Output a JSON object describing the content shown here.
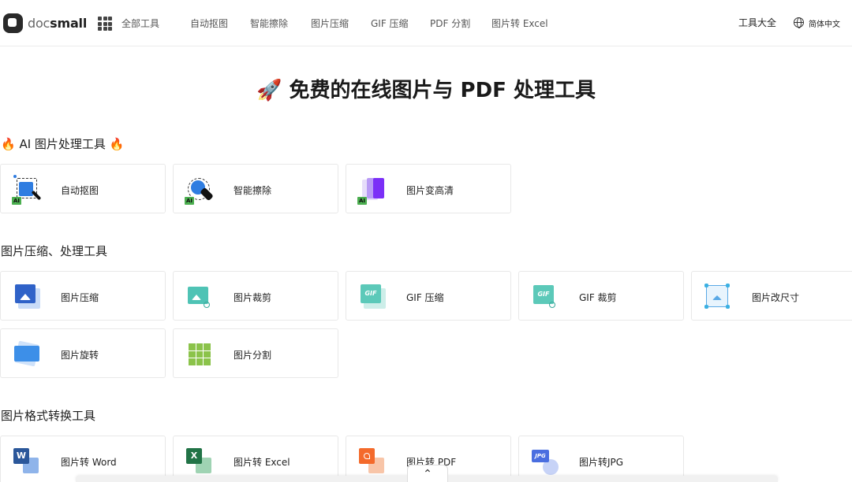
{
  "header": {
    "logo_prefix": "doc",
    "logo_suffix": "small",
    "all_tools": "全部工具",
    "nav": [
      "自动抠图",
      "智能擦除",
      "图片压缩",
      "GIF 压缩",
      "PDF 分割",
      "图片转 Excel"
    ],
    "tools_all": "工具大全",
    "language": "简体中文"
  },
  "hero": {
    "title": "🚀 免费的在线图片与 PDF 处理工具"
  },
  "sections": {
    "ai": {
      "title": "🔥 AI 图片处理工具 🔥",
      "cards": [
        "自动抠图",
        "智能擦除",
        "图片变高清"
      ],
      "tag": "AI"
    },
    "compress": {
      "title": "图片压缩、处理工具",
      "cards": [
        "图片压缩",
        "图片裁剪",
        "GIF 压缩",
        "GIF 裁剪",
        "图片改尺寸",
        "图片旋转",
        "图片分割"
      ]
    },
    "convert": {
      "title": "图片格式转换工具",
      "cards": [
        "图片转 Word",
        "图片转 Excel",
        "图片转 PDF",
        "图片转JPG"
      ]
    }
  },
  "icon_glyphs": {
    "gif": "GIF",
    "word": "W",
    "excel": "X",
    "jpg": "JPG"
  },
  "icons": [
    "grid-icon",
    "globe-icon",
    "cutout-icon",
    "erase-icon",
    "enhance-icon",
    "compress-icon",
    "crop-icon",
    "gif-compress-icon",
    "gif-crop-icon",
    "resize-icon",
    "rotate-icon",
    "split-icon",
    "word-icon",
    "excel-icon",
    "pdf-icon",
    "jpg-icon",
    "chevron-up-icon"
  ],
  "colors": {
    "ai_tag": "#4caf50",
    "blue": "#2f7de1",
    "teal": "#4fc3b5",
    "purple": "#7b2ff7",
    "green": "#8bc34a",
    "word": "#2b579a",
    "excel": "#217346",
    "pdf": "#f46a2b"
  },
  "scroll_top": "⌃"
}
